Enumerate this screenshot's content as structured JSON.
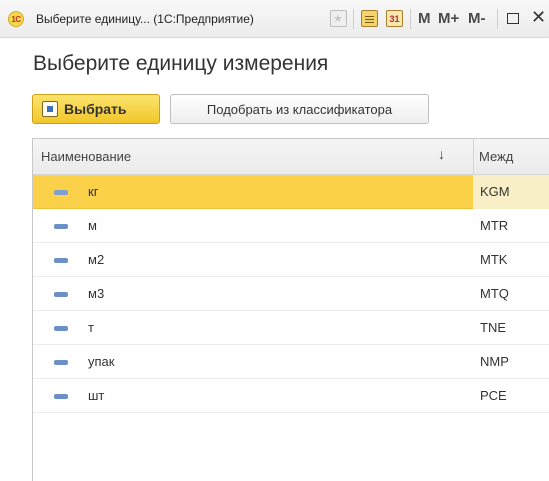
{
  "window": {
    "app_logo": "1С",
    "title": "Выберите единицу... (1С:Предприятие)",
    "toolbar": {
      "calendar_day": "31",
      "m_label": "M",
      "m_plus_label": "M+",
      "m_minus_label": "M-",
      "close_label": "✕"
    }
  },
  "page": {
    "title": "Выберите единицу измерения"
  },
  "actions": {
    "select_label": "Выбрать",
    "pick_label": "Подобрать из классификатора"
  },
  "table": {
    "columns": {
      "name": "Наименование",
      "code": "Межд",
      "sort_glyph": "↓"
    },
    "rows": [
      {
        "name": "кг",
        "code": "KGM",
        "selected": true
      },
      {
        "name": "м",
        "code": "MTR",
        "selected": false
      },
      {
        "name": "м2",
        "code": "MTK",
        "selected": false
      },
      {
        "name": "м3",
        "code": "MTQ",
        "selected": false
      },
      {
        "name": "т",
        "code": "TNE",
        "selected": false
      },
      {
        "name": "упак",
        "code": "NMP",
        "selected": false
      },
      {
        "name": "шт",
        "code": "PCE",
        "selected": false
      }
    ]
  },
  "colors": {
    "accent_yellow": "#fbd14a",
    "button_yellow": "#f1c62a",
    "item_marker": "#6d8fc7"
  }
}
